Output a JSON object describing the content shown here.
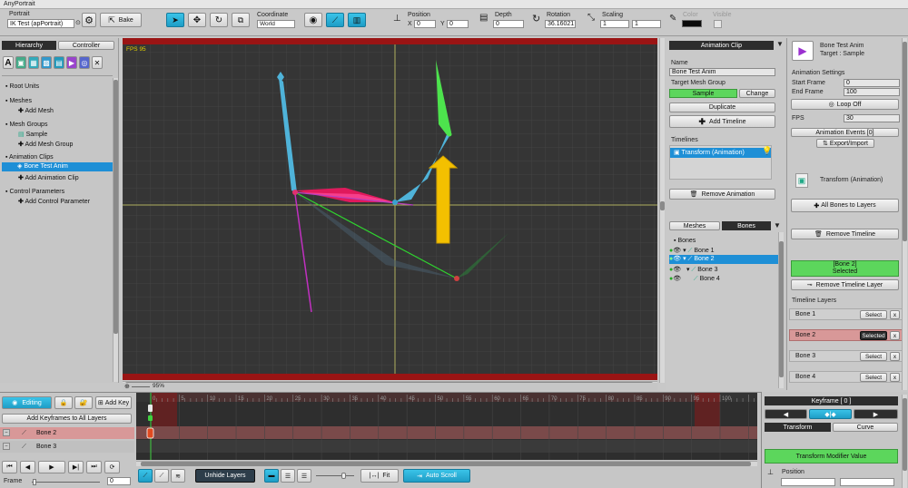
{
  "window": {
    "title": "AnyPortrait"
  },
  "toolbar": {
    "portrait_label": "Portrait",
    "portrait_value": "IK Test (apPortrait)",
    "bake_label": "Bake",
    "coordinate_label": "Coordinate",
    "coordinate_value": "World",
    "position_label": "Position",
    "pos_x_label": "X",
    "pos_x": "0",
    "pos_y_label": "Y",
    "pos_y": "0",
    "depth_label": "Depth",
    "depth": "0",
    "rotation_label": "Rotation",
    "rotation": "36.16021",
    "scaling_label": "Scaling",
    "scale_x": "1",
    "scale_y": "1",
    "color_label": "Color",
    "visible_label": "Visible"
  },
  "hierarchy": {
    "tabs": [
      "Hierarchy",
      "Controller"
    ],
    "root_units": "Root Units",
    "meshes": "Meshes",
    "add_mesh": "Add Mesh",
    "mesh_groups": "Mesh Groups",
    "sample": "Sample",
    "add_mesh_group": "Add Mesh Group",
    "animation_clips": "Animation Clips",
    "bone_test_anim": "Bone Test Anim",
    "add_animation_clip": "Add Animation Clip",
    "control_parameters": "Control Parameters",
    "add_control_parameter": "Add Control Parameter"
  },
  "viewport": {
    "fps": "FPS 95",
    "zoom": "95%"
  },
  "anim_panel": {
    "header": "Animation Clip",
    "name_label": "Name",
    "name_value": "Bone Test Anim",
    "target_label": "Target Mesh Group",
    "target_value": "Sample",
    "change": "Change",
    "duplicate": "Duplicate",
    "add_timeline": "Add Timeline",
    "timelines_label": "Timelines",
    "timeline_item": "Transform (Animation)",
    "remove_animation": "Remove Animation",
    "tabs": [
      "Meshes",
      "Bones"
    ],
    "bones_root": "Bones",
    "bones": [
      "Bone 1",
      "Bone 2",
      "Bone 3",
      "Bone 4"
    ]
  },
  "right_panel": {
    "clip_name": "Bone Test Anim",
    "target": "Target : Sample",
    "settings_label": "Animation Settings",
    "start_frame_label": "Start Frame",
    "start_frame": "0",
    "end_frame_label": "End Frame",
    "end_frame": "100",
    "loop_off": "Loop Off",
    "fps_label": "FPS",
    "fps": "30",
    "animation_events": "Animation Events [0]",
    "export_import": "Export/Import",
    "timeline_name": "Transform (Animation)",
    "all_bones": "All Bones to Layers",
    "remove_timeline": "Remove Timeline",
    "selected_box_line1": "[Bone 2]",
    "selected_box_line2": "Selected",
    "remove_timeline_layer": "Remove Timeline Layer",
    "timeline_layers_label": "Timeline Layers",
    "layers": [
      {
        "name": "Bone 1",
        "button": "Select"
      },
      {
        "name": "Bone 2",
        "button": "Selected"
      },
      {
        "name": "Bone 3",
        "button": "Select"
      },
      {
        "name": "Bone 4",
        "button": "Select"
      }
    ],
    "x_label": "x"
  },
  "timeline": {
    "editing": "Editing",
    "add_key": "Add Key",
    "add_keyframes_all": "Add Keyframes to All Layers",
    "rows": [
      "Bone 2",
      "Bone 3"
    ],
    "frame_label": "Frame",
    "frame_value": "0",
    "unhide_layers": "Unhide Layers",
    "fit": "Fit",
    "auto_scroll": "Auto Scroll",
    "ruler": [
      "0",
      "5",
      "10",
      "15",
      "20",
      "25",
      "30",
      "35",
      "40",
      "45",
      "50",
      "55",
      "60",
      "65",
      "70",
      "75",
      "80",
      "85",
      "90",
      "95",
      "100"
    ]
  },
  "keyframe_panel": {
    "header": "Keyframe [ 0 ]",
    "tabs": [
      "Transform",
      "Curve"
    ],
    "modifier_value": "Transform Modifier Value",
    "position_label": "Position"
  },
  "colors": {
    "accent": "#29b6e0",
    "selected_row": "#1e8fd6",
    "green": "#5cd65c",
    "bone_blue": "#4fb3d9",
    "bone_red": "#e0195c",
    "viewport_bg": "#353535"
  }
}
